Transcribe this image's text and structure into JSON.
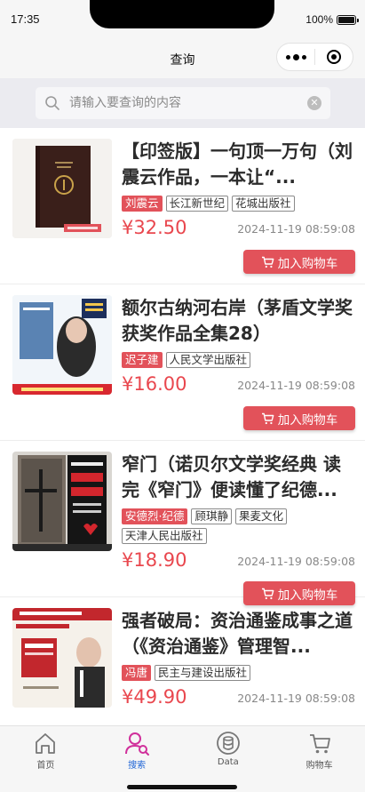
{
  "status_bar": {
    "time": "17:35",
    "battery": "100%"
  },
  "nav": {
    "title": "查询"
  },
  "search": {
    "placeholder": "请输入要查询的内容",
    "value": ""
  },
  "colors": {
    "accent": "#e2525a",
    "price": "#e9474e",
    "tab_active": "#2166d6",
    "tab_active_icon": "#d0309b"
  },
  "products": [
    {
      "title": "【印签版】一句顶一万句（刘震云作品，一本让“...",
      "tags": [
        "刘震云",
        "长江新世纪",
        "花城出版社"
      ],
      "price": "¥32.50",
      "date": "2024-11-19 08:59:08",
      "cart_label": "加入购物车",
      "cover_icon": "book-cover-dark-brown"
    },
    {
      "title": "额尔古纳河右岸（茅盾文学奖获奖作品全集28）",
      "tags": [
        "迟子建",
        "人民文学出版社"
      ],
      "price": "¥16.00",
      "date": "2024-11-19 08:59:08",
      "cart_label": "加入购物车",
      "cover_icon": "book-cover-blue-portrait"
    },
    {
      "title": "窄门（诺贝尔文学奖经典 读完《窄门》便读懂了纪德...",
      "tags": [
        "安德烈·纪德",
        "顾琪静",
        "果麦文化",
        "天津人民出版社"
      ],
      "price": "¥18.90",
      "date": "2024-11-19 08:59:08",
      "cart_label": "加入购物车",
      "cover_icon": "book-cover-black-red"
    },
    {
      "title": "强者破局：资治通鉴成事之道（《资治通鉴》管理智...",
      "tags": [
        "冯唐",
        "民主与建设出版社"
      ],
      "price": "¥49.90",
      "date": "2024-11-19 08:59:08",
      "cart_label": "加入购物车",
      "cover_icon": "book-cover-red-portrait"
    }
  ],
  "tabs": [
    {
      "label": "首页",
      "icon": "home-icon",
      "active": false
    },
    {
      "label": "搜索",
      "icon": "search-person-icon",
      "active": true
    },
    {
      "label": "Data",
      "icon": "data-icon",
      "active": false
    },
    {
      "label": "购物车",
      "icon": "cart-icon",
      "active": false
    }
  ]
}
